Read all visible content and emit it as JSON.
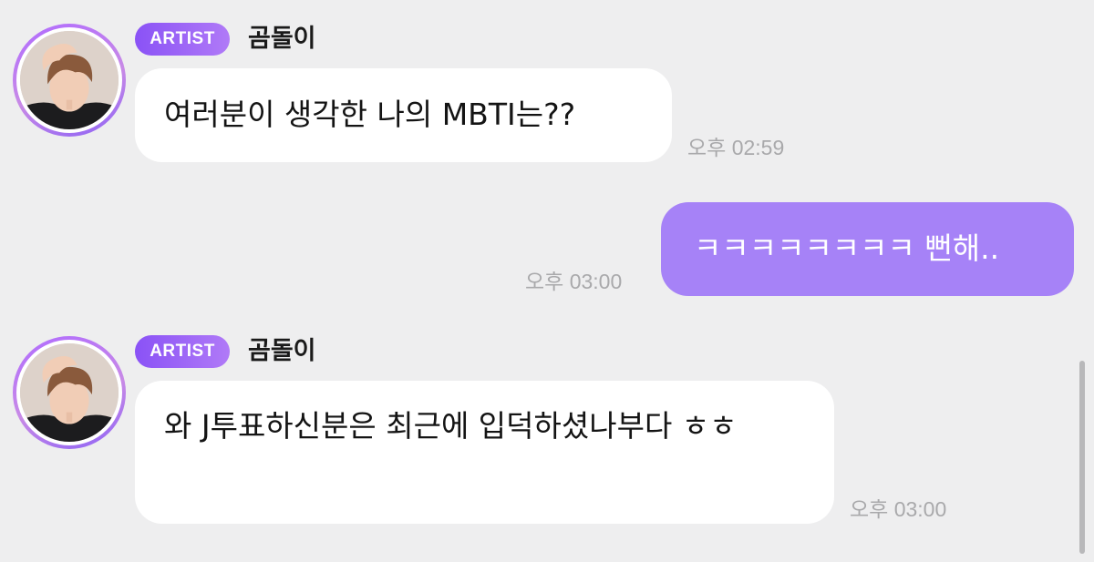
{
  "messages": [
    {
      "badge": "ARTIST",
      "sender": "곰돌이",
      "text": "여러분이 생각한 나의 MBTI는??",
      "time": "오후 02:59"
    },
    {
      "text": "ㅋㅋㅋㅋㅋㅋㅋㅋ 뻔해..",
      "time": "오후 03:00"
    },
    {
      "badge": "ARTIST",
      "sender": "곰돌이",
      "text": "와 J투표하신분은 최근에 입덕하셨나부다 ㅎㅎ",
      "time": "오후 03:00"
    }
  ],
  "colors": {
    "background": "#eeeeef",
    "my_bubble": "#a682f7",
    "artist_badge": "#8a52f6",
    "timestamp": "#a9a9ab"
  },
  "icons": {
    "avatar": "artist-profile-photo",
    "badge": "artist-badge"
  }
}
